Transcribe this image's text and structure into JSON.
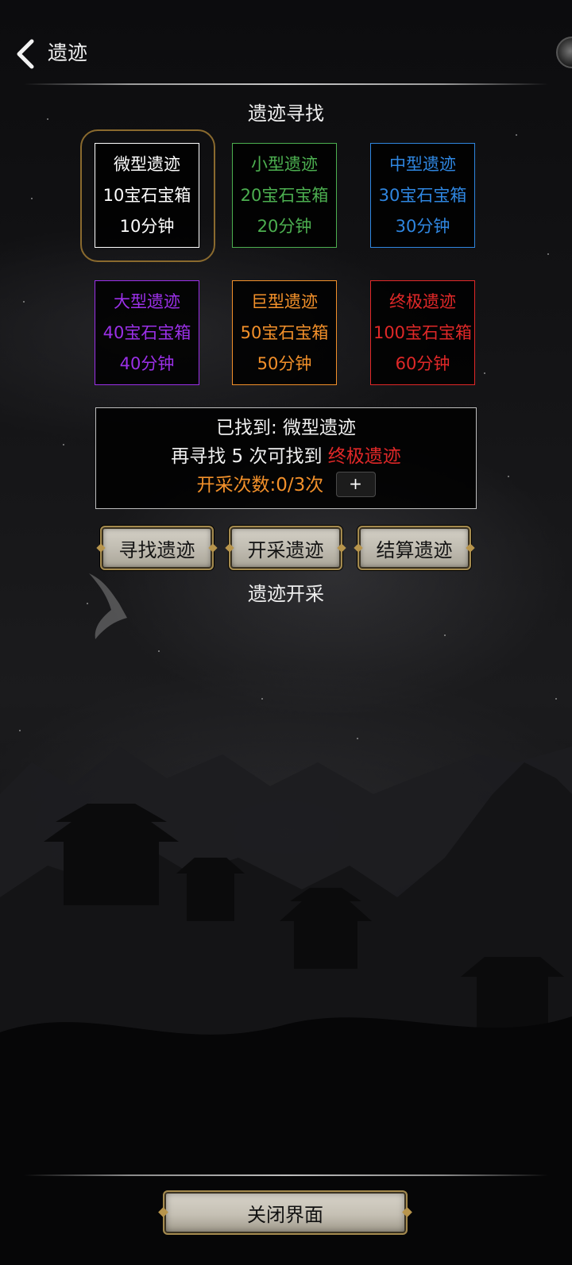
{
  "header": {
    "title": "遗迹"
  },
  "search_section": {
    "title": "遗迹寻找"
  },
  "ruins": [
    {
      "name": "微型遗迹",
      "reward": "10宝石宝箱",
      "duration": "10分钟",
      "color": "#ffffff",
      "name_color": "#ffffff",
      "selected": true
    },
    {
      "name": "小型遗迹",
      "reward": "20宝石宝箱",
      "duration": "20分钟",
      "color": "#4caf50",
      "name_color": "#4caf50"
    },
    {
      "name": "中型遗迹",
      "reward": "30宝石宝箱",
      "duration": "30分钟",
      "color": "#2f86e0",
      "name_color": "#2f86e0"
    },
    {
      "name": "大型遗迹",
      "reward": "40宝石宝箱",
      "duration": "40分钟",
      "color": "#9b30e8",
      "name_color": "#9b30e8"
    },
    {
      "name": "巨型遗迹",
      "reward": "50宝石宝箱",
      "duration": "50分钟",
      "color": "#f2902a",
      "name_color": "#f2902a"
    },
    {
      "name": "终极遗迹",
      "reward": "100宝石宝箱",
      "duration": "60分钟",
      "color": "#e02828",
      "name_color": "#e02828"
    }
  ],
  "info": {
    "found_label": "已找到:",
    "found_value": "微型遗迹",
    "search_prefix": "再寻找",
    "search_count": "5",
    "search_suffix": "次可找到",
    "target_ruin": "终极遗迹",
    "mining_label": "开采次数:",
    "mining_value": "0/3次",
    "plus_label": "+"
  },
  "actions": {
    "search": "寻找遗迹",
    "mine": "开采遗迹",
    "settle": "结算遗迹"
  },
  "mining_section": {
    "title": "遗迹开采"
  },
  "footer": {
    "close_label": "关闭界面"
  },
  "colors": {
    "accent_gold": "#a48a4e",
    "highlight_red": "#e02828",
    "orange": "#f2902a"
  },
  "icons": {
    "back": "chevron-left-icon",
    "corner": "orb-icon"
  }
}
